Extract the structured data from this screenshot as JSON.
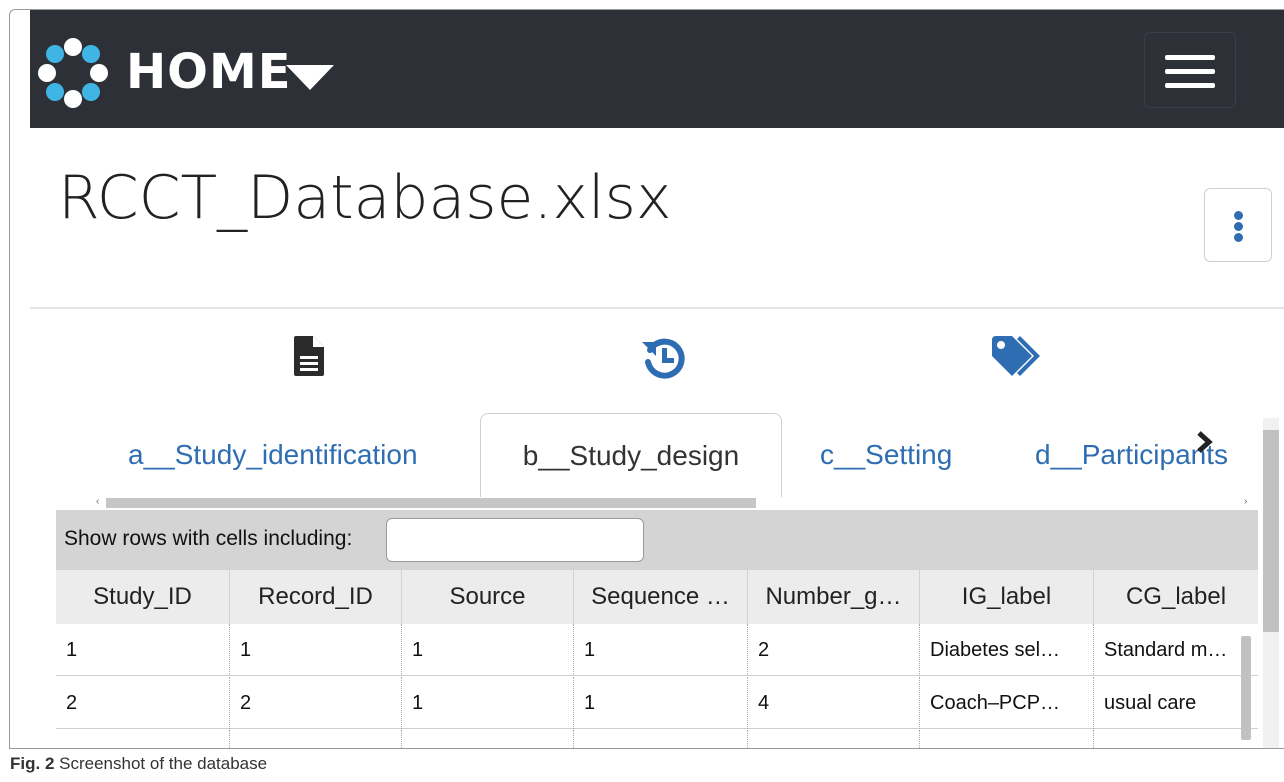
{
  "navbar": {
    "home_label": "HOME",
    "logo_icon": "bubble-ring-logo",
    "menu_icon": "hamburger-icon"
  },
  "page": {
    "title": "RCCT_Database.xlsx",
    "options_icon": "kebab-icon"
  },
  "toolbar_icons": [
    "file-icon",
    "history-icon",
    "tags-icon"
  ],
  "tabs": [
    {
      "label": "a__Study_identification",
      "active": false
    },
    {
      "label": "b__Study_design",
      "active": true
    },
    {
      "label": "c__Setting",
      "active": false
    },
    {
      "label": "d__Participants",
      "active": false
    }
  ],
  "filter": {
    "label": "Show rows with cells including:",
    "value": ""
  },
  "table": {
    "columns": [
      "Study_ID",
      "Record_ID",
      "Source",
      "Sequence …",
      "Number_g…",
      "IG_label",
      "CG_label"
    ],
    "rows": [
      [
        "1",
        "1",
        "1",
        "1",
        "2",
        "Diabetes sel…",
        "Standard m…"
      ],
      [
        "2",
        "2",
        "1",
        "1",
        "4",
        "Coach–PCP…",
        "usual care"
      ]
    ]
  },
  "caption": {
    "fig": "Fig. 2",
    "text": "Screenshot of the database"
  },
  "colors": {
    "navbar_bg": "#2d3037",
    "accent_blue": "#2f6db3",
    "logo_light_blue": "#3fb5e6"
  }
}
